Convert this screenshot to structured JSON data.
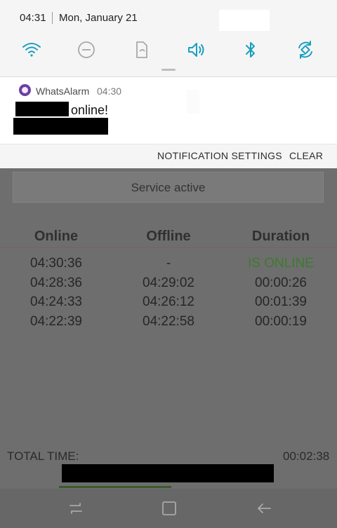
{
  "status_bar": {
    "time": "04:31",
    "date": "Mon, January 21"
  },
  "quick_settings": [
    {
      "icon": "wifi-icon",
      "active": true
    },
    {
      "icon": "do-not-disturb-icon",
      "active": false
    },
    {
      "icon": "portrait-lock-icon",
      "active": false
    },
    {
      "icon": "sound-icon",
      "active": true
    },
    {
      "icon": "bluetooth-icon",
      "active": true
    },
    {
      "icon": "auto-rotate-icon",
      "active": true
    }
  ],
  "colors": {
    "accent": "#1a9fbf",
    "inactive": "#9e9e9e",
    "online_green": "#3f7a2e"
  },
  "notification": {
    "app_name": "WhatsAlarm",
    "time": "04:30",
    "text": "online!",
    "settings_label": "NOTIFICATION SETTINGS",
    "clear_label": "CLEAR"
  },
  "app": {
    "service_status": "Service active",
    "columns": [
      "Online",
      "Offline",
      "Duration"
    ],
    "rows": [
      [
        "04:30:36",
        "-",
        "IS ONLINE"
      ],
      [
        "04:28:36",
        "04:29:02",
        "00:00:26"
      ],
      [
        "04:24:33",
        "04:26:12",
        "00:01:39"
      ],
      [
        "04:22:39",
        "04:22:58",
        "00:00:19"
      ]
    ],
    "total_label": "TOTAL TIME:",
    "total_value": "00:02:38"
  },
  "navbar": [
    "recent-apps-icon",
    "home-icon",
    "back-icon"
  ]
}
